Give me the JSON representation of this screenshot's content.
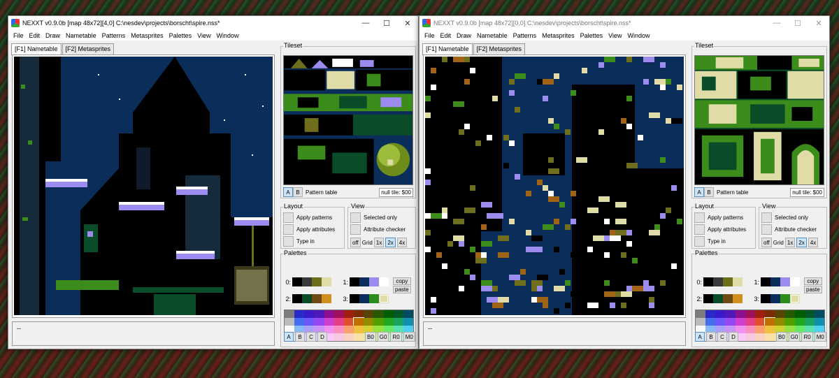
{
  "windows": [
    {
      "id": "left",
      "title": "NEXXT v0.9.0b  [map 48x72][4,0] C:\\nesdev\\projects\\borscht\\spire.nss*",
      "menu": [
        "File",
        "Edit",
        "Draw",
        "Nametable",
        "Patterns",
        "Metasprites",
        "Palettes",
        "View",
        "Window"
      ],
      "tabs": [
        "[F1] Nametable",
        "[F2] Metasprites"
      ],
      "status": "--",
      "tileset": {
        "label": "Tileset",
        "btn_a": "A",
        "btn_b": "B",
        "pattern_table": "Pattern table",
        "null_tile": "null tile: $00"
      },
      "layout": {
        "label": "Layout",
        "apply_patterns": "Apply patterns",
        "apply_attributes": "Apply attributes",
        "type_in": "Type in"
      },
      "view": {
        "label": "View",
        "selected_only": "Selected only",
        "attribute_checker": "Attribute checker",
        "off": "off",
        "grid": "Grid",
        "g1": "1x",
        "g2": "2x",
        "g4": "4x"
      },
      "palettes": {
        "label": "Palettes",
        "p0": "0:",
        "p1": "1:",
        "p2": "2:",
        "p3": "3:",
        "copy": "copy",
        "paste": "paste"
      },
      "bottom": {
        "a": "A",
        "b": "B",
        "c": "C",
        "d": "D",
        "b0": "B0",
        "g0": "G0",
        "r0": "R0",
        "m0": "M0"
      }
    },
    {
      "id": "right",
      "title": "NEXXT v0.9.0b  [map 48x72][0,0] C:\\nesdev\\projects\\borscht\\spire.nss*",
      "menu": [
        "File",
        "Edit",
        "Draw",
        "Nametable",
        "Patterns",
        "Metasprites",
        "Palettes",
        "View",
        "Window"
      ],
      "tabs": [
        "[F1] Nametable",
        "[F2] Metasprites"
      ],
      "status": "--",
      "tileset": {
        "label": "Tileset",
        "btn_a": "A",
        "btn_b": "B",
        "pattern_table": "Pattern table",
        "null_tile": "null tile: $00"
      },
      "layout": {
        "label": "Layout",
        "apply_patterns": "Apply patterns",
        "apply_attributes": "Apply attributes",
        "type_in": "Type in"
      },
      "view": {
        "label": "View",
        "selected_only": "Selected only",
        "attribute_checker": "Attribute checker",
        "off": "off",
        "grid": "Grid",
        "g1": "1x",
        "g2": "2x",
        "g4": "4x"
      },
      "palettes": {
        "label": "Palettes",
        "p0": "0:",
        "p1": "1:",
        "p2": "2:",
        "p3": "3:",
        "copy": "copy",
        "paste": "paste"
      },
      "bottom": {
        "a": "A",
        "b": "B",
        "c": "C",
        "d": "D",
        "b0": "B0",
        "g0": "G0",
        "r0": "R0",
        "m0": "M0"
      }
    }
  ],
  "colors": {
    "sky": "#0b2d5a",
    "black": "#000000",
    "lavender": "#9c8cf0",
    "white": "#ffffff",
    "green": "#3c8c1c",
    "olive": "#6e6e1c",
    "cream": "#e0dca8",
    "brown": "#a06414",
    "dkgreen": "#0a4c28"
  },
  "palette_rows": {
    "p0": [
      "#000000",
      "#3a3a3a",
      "#6e6e1c",
      "#e0dca8"
    ],
    "p1": [
      "#000000",
      "#0b2d5a",
      "#9c8cf0",
      "#ffffff"
    ],
    "p2": [
      "#000000",
      "#0a4c28",
      "#6e4a14",
      "#d09020"
    ],
    "p3": [
      "#000000",
      "#0b2d5a",
      "#2c8c1c",
      "#e0dca8"
    ]
  },
  "master_palette": [
    "#7c7c7c",
    "#2a2ac8",
    "#3818c8",
    "#5018b8",
    "#8c1090",
    "#a0105c",
    "#a02010",
    "#7c2c00",
    "#584400",
    "#285800",
    "#005c00",
    "#005828",
    "#004c60",
    "#bcbcbc",
    "#4470f0",
    "#6c58f8",
    "#9848f0",
    "#d040d0",
    "#e44088",
    "#e05030",
    "#c07000",
    "#948c00",
    "#50a000",
    "#20a820",
    "#18a460",
    "#1090b0",
    "#f8f8f8",
    "#88b8f8",
    "#a8a0f8",
    "#c894f8",
    "#f090f0",
    "#f890c0",
    "#f8a070",
    "#f0c040",
    "#d0d030",
    "#98e040",
    "#68e868",
    "#58e0b0",
    "#50d0f0",
    "#fcfcfc",
    "#c4dcf8",
    "#d4d0f8",
    "#e0ccf8",
    "#f8c8f8",
    "#f8c8e0",
    "#f8d4c0",
    "#f8e0a8",
    "#ece8a0",
    "#d0f0a0",
    "#b8f4b8",
    "#b0f0d8",
    "#a8e8f8"
  ]
}
